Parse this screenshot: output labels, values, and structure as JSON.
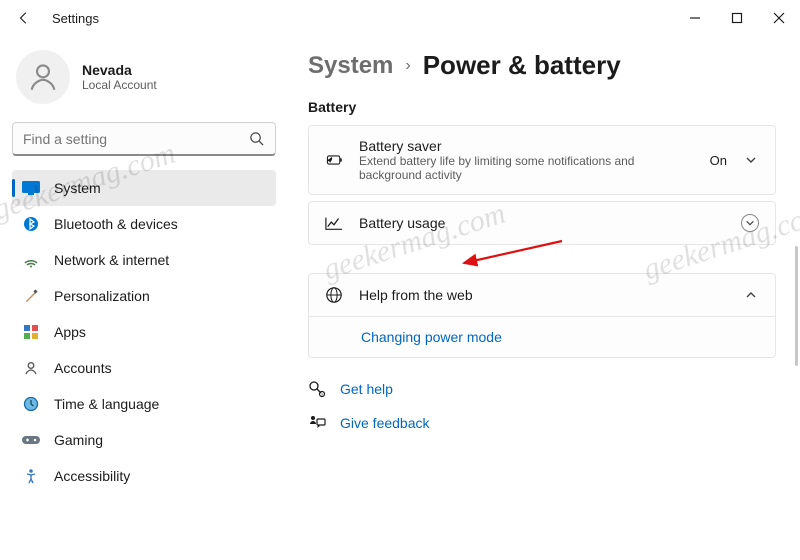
{
  "window": {
    "title": "Settings"
  },
  "user": {
    "name": "Nevada",
    "sub": "Local Account"
  },
  "search": {
    "placeholder": "Find a setting"
  },
  "sidebar": {
    "items": [
      {
        "label": "System"
      },
      {
        "label": "Bluetooth & devices"
      },
      {
        "label": "Network & internet"
      },
      {
        "label": "Personalization"
      },
      {
        "label": "Apps"
      },
      {
        "label": "Accounts"
      },
      {
        "label": "Time & language"
      },
      {
        "label": "Gaming"
      },
      {
        "label": "Accessibility"
      }
    ]
  },
  "breadcrumb": {
    "parent": "System",
    "current": "Power & battery"
  },
  "section": {
    "title": "Battery"
  },
  "cards": {
    "saver": {
      "title": "Battery saver",
      "sub": "Extend battery life by limiting some notifications and background activity",
      "state": "On"
    },
    "usage": {
      "title": "Battery usage"
    },
    "help": {
      "title": "Help from the web",
      "link": "Changing power mode"
    }
  },
  "footer": {
    "help": "Get help",
    "feedback": "Give feedback"
  },
  "watermark": "geekermag.com",
  "colors": {
    "accent": "#0067c0"
  }
}
